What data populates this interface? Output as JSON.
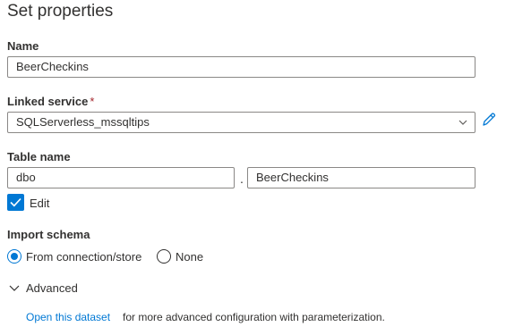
{
  "panel": {
    "title": "Set properties",
    "name_label": "Name",
    "name_value": "BeerCheckins",
    "linked_service_label": "Linked service",
    "required_marker": "*",
    "linked_service_value": "SQLServerless_mssqltips",
    "table_name_label": "Table name",
    "schema_value": "dbo",
    "separator": ".",
    "table_value": "BeerCheckins",
    "edit_label": "Edit",
    "edit_checked": true,
    "import_schema_label": "Import schema",
    "import_options": [
      {
        "label": "From connection/store",
        "selected": true
      },
      {
        "label": "None",
        "selected": false
      }
    ],
    "advanced_label": "Advanced",
    "open_link_text": "Open this dataset",
    "open_link_tail": "for more advanced configuration with parameterization."
  },
  "icons": {
    "pencil": "pencil-edit-icon",
    "chevron": "chevron-down-icon",
    "check": "checkmark-icon"
  },
  "colors": {
    "accent": "#0078d4",
    "required": "#a4262c",
    "text": "#323130",
    "border": "#8a8886"
  }
}
